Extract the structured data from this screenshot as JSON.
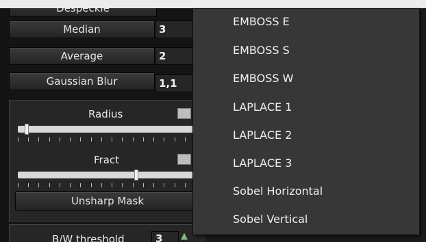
{
  "filters": {
    "top_label": "Despeckle",
    "median_label": "Median",
    "median_value": "3",
    "average_label": "Average",
    "average_value": "2",
    "gaussian_label": "Gaussian Blur",
    "gaussian_value": "1,1"
  },
  "sharpen": {
    "radius_label": "Radius",
    "fract_label": "Fract",
    "radius_level": 0.04,
    "fract_level": 0.67,
    "button_label": "Unsharp Mask"
  },
  "threshold": {
    "label": "B/W threshold",
    "value": "3"
  },
  "menu": {
    "items": [
      {
        "label": "EMBOSS E"
      },
      {
        "label": "EMBOSS S"
      },
      {
        "label": "EMBOSS W"
      },
      {
        "label": "LAPLACE 1"
      },
      {
        "label": "LAPLACE 2"
      },
      {
        "label": "LAPLACE 3"
      },
      {
        "label": "Sobel Horizontal"
      },
      {
        "label": "Sobel Vertical"
      }
    ]
  }
}
